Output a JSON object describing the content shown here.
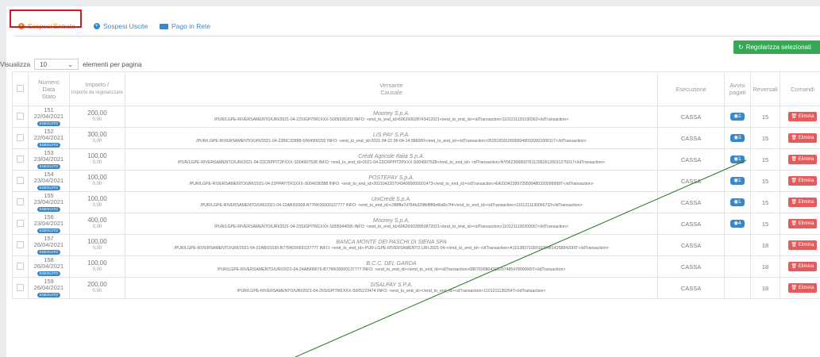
{
  "tabs": [
    {
      "label": "Sospesi Entrate"
    },
    {
      "label": "Sospesi Uscite"
    },
    {
      "label": "Pago in Rete"
    }
  ],
  "actions": {
    "regolarizza": "Regolarizza selezionati"
  },
  "pager": {
    "prefix": "Visualizza",
    "value": "10",
    "suffix": "elementi per pagina"
  },
  "columns": {
    "numero": "Numero",
    "data": "Data",
    "stato": "Stato",
    "importo": "Importo /",
    "importo_sub": "Importo da regolarizzare",
    "versante": "Versante",
    "causale": "Causale",
    "esecuzione": "Esecuzione",
    "avvisi": "Avvisi pagati",
    "reversali": "Reversali",
    "comandi": "Comandi"
  },
  "rows": [
    {
      "num": "151",
      "date": "22/04/2021",
      "stato": "ESEGUITO",
      "importo": "200,00",
      "regolarizzare": "0,00",
      "versante": "Mooney S.p.A.",
      "causale": "/PUR/LGPE-RIVERSAMENTO/URI/2021-04-22SIGPITM1XXX-S005326203 INFO: <end_to_end_id>606260028743412021</end_to_end_id><idTransaction>1101211120190362</idTransaction>",
      "esecuzione": "CASSA",
      "avvisi": "2",
      "reversali": "15",
      "comando": "Elimina"
    },
    {
      "num": "152",
      "date": "22/04/2021",
      "stato": "ESEGUITO",
      "importo": "300,00",
      "regolarizzare": "0,00",
      "versante": "LIS PAY S.P.A.",
      "causale": "/PUR/LGPE-RIVERSAMENTO/URI/2021-04-22BIC32888-S004900292 INFO: <end_to_end_id>2021-04-22 06-04-14.886000</end_to_end_id><idTransaction>95351818105000048032000100011T</idTransaction>",
      "esecuzione": "CASSA",
      "avvisi": "3",
      "reversali": "15",
      "comando": "Elimina"
    },
    {
      "num": "153",
      "date": "23/04/2021",
      "stato": "ESEGUITO",
      "importo": "100,00",
      "regolarizzare": "0,00",
      "versante": "Crédit Agricole Italia S.p.A.",
      "causale": "/PUR/LGPE-RIVERSAMENTO/URI/2021-04-22CRPPIT2PXXX-S004907528 INFO: <end_to_end_id>2021-04-22CRPPIT2PXXX-S004907528</end_to_end_id> <idTransaction>NY062306893761129926126011275017</idTransaction>",
      "esecuzione": "CASSA",
      "avvisi": "1",
      "reversali": "15",
      "comando": "Elimina"
    },
    {
      "num": "154",
      "date": "23/04/2021",
      "stato": "ESEGUITO",
      "importo": "100,00",
      "regolarizzare": "0,00",
      "versante": "POSTEPAY S.p.A.",
      "causale": "/PUR/LGPE-RIVERSAMENTO/URI/2021-04-22PPAYITR1XXX-S004930388 INFO: <end_to_end_id>20210422070434000000001473</end_to_end_id><idTransaction>EA21042289729500480320099999T</idTransaction>",
      "esecuzione": "CASSA",
      "avvisi": "1",
      "reversali": "15",
      "comando": "Elimina"
    },
    {
      "num": "155",
      "date": "23/04/2021",
      "stato": "ESEGUITO",
      "importo": "100,00",
      "regolarizzare": "0,00",
      "versante": "UniCredit S.p.A.",
      "causale": "/PUR/LGPE-RIVERSAMENTO/URI/2021-04-22ABI02008-B77RK00000137777 INFO: <end_to_end_id>c3f8fffa7d784b329fbf8f6b46d0c7f4</end_to_end_id><idTransaction>1101211130066733</idTransaction>",
      "esecuzione": "CASSA",
      "avvisi": "1",
      "reversali": "15",
      "comando": "Elimina"
    },
    {
      "num": "156",
      "date": "23/04/2021",
      "stato": "ESEGUITO",
      "importo": "400,00",
      "regolarizzare": "0,00",
      "versante": "Mooney S.p.A.",
      "causale": "/PUR/LGPE-RIVERSAMENTO/URI/2021-04-23SIGPITM1XXX-S005044095 INFO: <end_to_end_id>606260028953872021</end_to_end_id><idTransaction>1101211130200067</idTransaction>",
      "esecuzione": "CASSA",
      "avvisi": "4",
      "reversali": "15",
      "comando": "Elimina"
    },
    {
      "num": "157",
      "date": "26/04/2021",
      "stato": "ESEGUITO",
      "importo": "100,00",
      "regolarizzare": "0,00",
      "versante": "BANCA MONTE DEI PASCHI DI SIENA SPA",
      "causale": "/PUR/LGPE-RIVERSAMENTO/URI/2021-04-22ABI01030-B77RK00000137777 INFO: <end_to_end_id>-PUR-LGPE-RIVERSAMENTO.URI.2021-04-</end_to_end_id> <idTransaction>A101383710901030481425884200IT</idTransaction>",
      "esecuzione": "CASSA",
      "avvisi": "",
      "reversali": "18",
      "comando": "Elimina"
    },
    {
      "num": "158",
      "date": "26/04/2021",
      "stato": "ESEGUITO",
      "importo": "100,00",
      "regolarizzare": "0,00",
      "versante": "B.C.C. DEL GARDA",
      "causale": "/PUR/LGPE-RIVERSAMENTO/URI/2021-04-24ABI08676-B77RK00000137777 INFO: <end_to_end_id></end_to_end_id><idTransaction>086760080431220748547800000IT</idTransaction>",
      "esecuzione": "CASSA",
      "avvisi": "",
      "reversali": "18",
      "comando": "Elimina"
    },
    {
      "num": "159",
      "date": "26/04/2021",
      "stato": "ESEGUITO",
      "importo": "200,00",
      "regolarizzare": "0,00",
      "versante": "SISALPAY S.P.A.",
      "causale": "/PUR/LGPE-RIVERSAMENTO/URI/2021-04-26SIGPITM1XXX-S005223474 INFO: <end_to_end_id></end_to_end_id><idTransaction>1101211130254T</idTransaction>",
      "esecuzione": "CASSA",
      "avvisi": "",
      "reversali": "18",
      "comando": "Elimina"
    }
  ]
}
